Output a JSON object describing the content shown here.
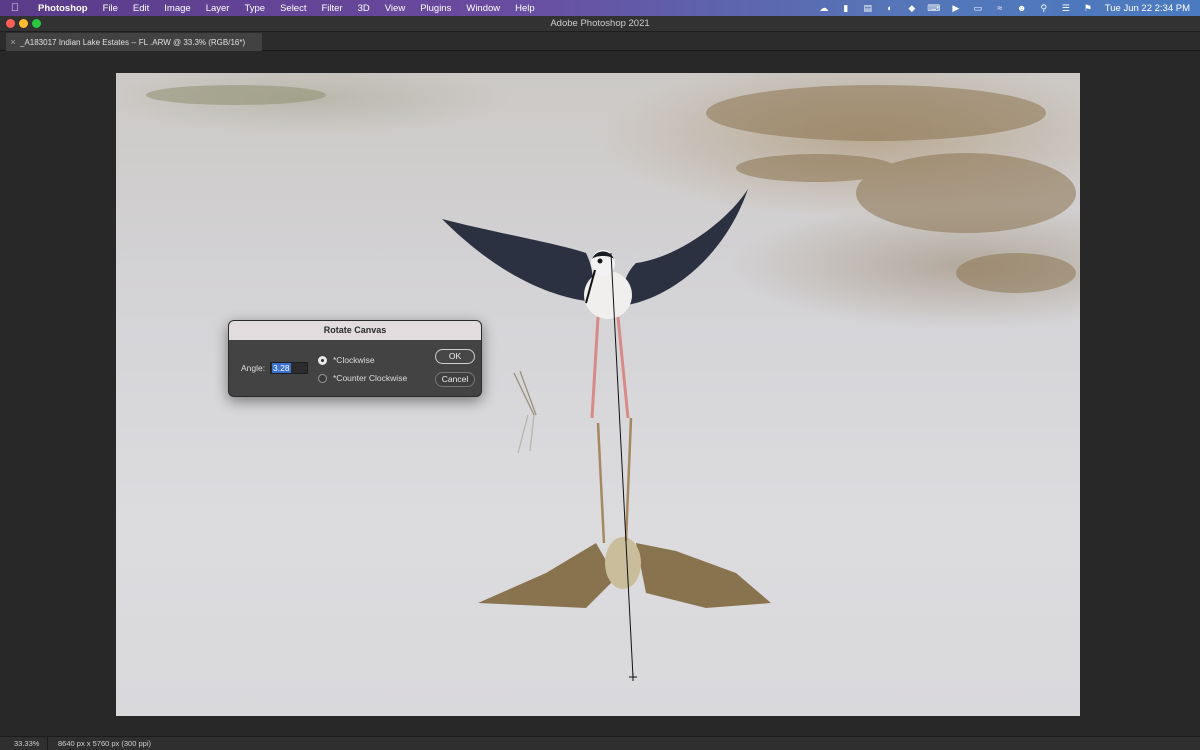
{
  "menubar": {
    "app_name": "Photoshop",
    "items": [
      "File",
      "Edit",
      "Image",
      "Layer",
      "Type",
      "Select",
      "Filter",
      "3D",
      "View",
      "Plugins",
      "Window",
      "Help"
    ],
    "clock": "Tue Jun 22  2:34 PM"
  },
  "window": {
    "title": "Adobe Photoshop 2021"
  },
  "document_tab": {
    "name": "_A183017 Indian Lake Estates -- FL .ARW @ 33.3% (RGB/16*)"
  },
  "dialog": {
    "title": "Rotate Canvas",
    "angle_label": "Angle:",
    "angle_value": "3.28",
    "option_cw": "*Clockwise",
    "option_ccw": "*Counter Clockwise",
    "selected_option": "cw",
    "ok_label": "OK",
    "cancel_label": "Cancel"
  },
  "statusbar": {
    "zoom": "33.33%",
    "doc_info": "8640 px x 5760 px (300 ppi)"
  },
  "colors": {
    "dialog_title_bg": "#e3dcde",
    "selection": "#3b6fd0"
  }
}
